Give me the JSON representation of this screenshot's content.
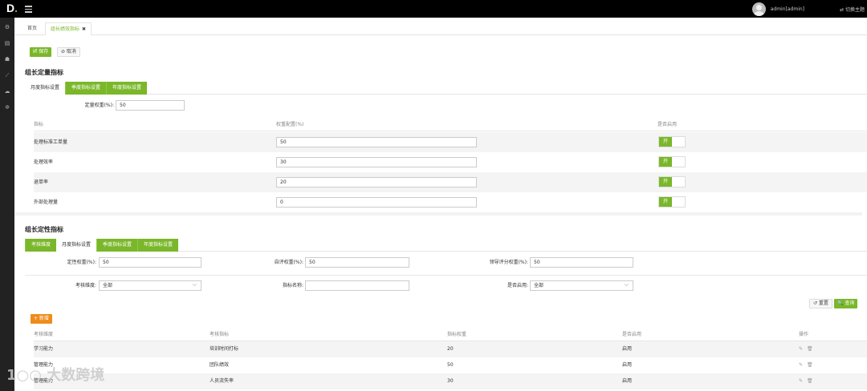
{
  "topbar": {
    "logo": "D",
    "logo_dot": ".",
    "user": "admin[admin]",
    "theme_toggle": "⇄ 切换主题"
  },
  "tabs": [
    {
      "label": "首页"
    },
    {
      "label": "组长绩效指标",
      "close": "✖"
    }
  ],
  "toolbar": {
    "save": "🗹 保存",
    "cancel": "⊘ 取消"
  },
  "quant": {
    "title": "组长定量指标",
    "tabs": [
      "月度指标设置",
      "季度指标设置",
      "年度指标设置"
    ],
    "weight_label": "定量权重(%):",
    "weight_value": "50",
    "headers": [
      "指标",
      "权重配置(%)",
      "是否启用"
    ],
    "rows": [
      {
        "name": "处理标准工单量",
        "value": "50",
        "toggle": "开"
      },
      {
        "name": "处理效率",
        "value": "30",
        "toggle": "开"
      },
      {
        "name": "退单率",
        "value": "20",
        "toggle": "开"
      },
      {
        "name": "外部处理量",
        "value": "0",
        "toggle": "开"
      }
    ]
  },
  "qual": {
    "title": "组长定性指标",
    "tabs": [
      "考核维度",
      "月度指标设置",
      "季度指标设置",
      "年度指标设置"
    ],
    "weights": [
      {
        "label": "定性权重(%):",
        "value": "50"
      },
      {
        "label": "自评权重(%):",
        "value": "50"
      },
      {
        "label": "领导评分权重(%):",
        "value": "50"
      }
    ],
    "filters": {
      "dimension_label": "考核维度:",
      "dimension_value": "全部",
      "name_label": "指标名称:",
      "name_value": "",
      "enabled_label": "是否启用:",
      "enabled_value": "全部"
    },
    "reset": "↺ 重置",
    "search": "🔍 查询",
    "add": "+ 新增",
    "headers": [
      "考核维度",
      "考核指标",
      "指标权重",
      "是否启用",
      "操作"
    ],
    "rows": [
      {
        "dim": "学习能力",
        "metric": "培训时间打标",
        "weight": "20",
        "enabled": "启用",
        "ops": "✎🗑"
      },
      {
        "dim": "管理能力",
        "metric": "团队绩效",
        "weight": "50",
        "enabled": "启用",
        "ops": "✎🗑"
      },
      {
        "dim": "管理能力",
        "metric": "人员流失率",
        "weight": "30",
        "enabled": "启用",
        "ops": "✎🗑"
      }
    ]
  },
  "watermark": "1○○ 大数跨境"
}
